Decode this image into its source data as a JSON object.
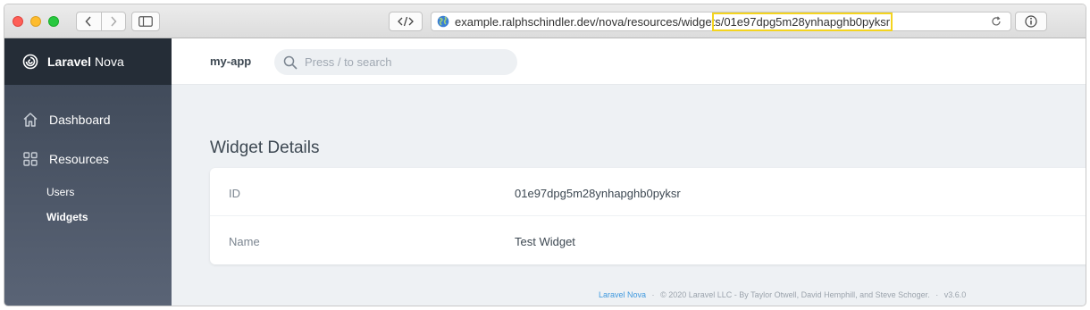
{
  "browser": {
    "url_prefix": "example.ralphschindler.dev/nova/resources/widget",
    "url_highlighted": "s/01e97dpg5m28ynhapghb0pyksr"
  },
  "sidebar": {
    "brand_bold": "Laravel",
    "brand_rest": "Nova",
    "dashboard_label": "Dashboard",
    "resources_label": "Resources",
    "sub_items": [
      {
        "label": "Users"
      },
      {
        "label": "Widgets"
      }
    ]
  },
  "header": {
    "app_name": "my-app",
    "search_placeholder": "Press / to search"
  },
  "page": {
    "title": "Widget Details",
    "fields": [
      {
        "label": "ID",
        "value": "01e97dpg5m28ynhapghb0pyksr"
      },
      {
        "label": "Name",
        "value": "Test Widget"
      }
    ]
  },
  "footer": {
    "link": "Laravel Nova",
    "sep1": "·",
    "copyright": "© 2020 Laravel LLC - By Taylor Otwell, David Hemphill, and Steve Schoger.",
    "sep2": "·",
    "version": "v3.6.0"
  }
}
